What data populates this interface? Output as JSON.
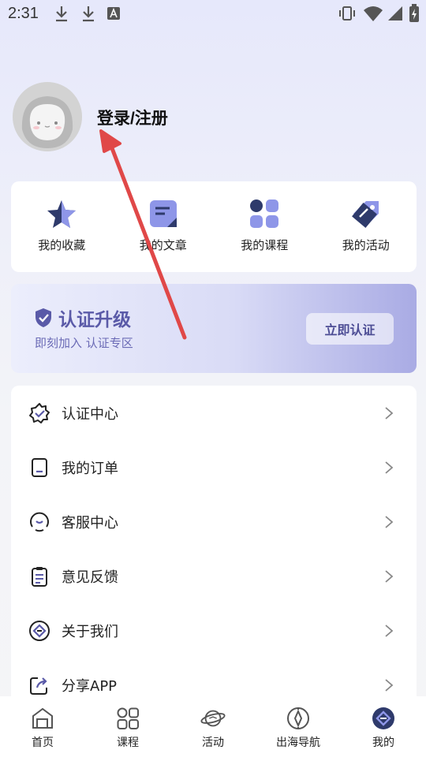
{
  "status_bar": {
    "time": "2:31"
  },
  "profile": {
    "login_text": "登录/注册"
  },
  "quick_actions": [
    {
      "label": "我的收藏",
      "icon": "star-icon"
    },
    {
      "label": "我的文章",
      "icon": "article-icon"
    },
    {
      "label": "我的课程",
      "icon": "course-grid-icon"
    },
    {
      "label": "我的活动",
      "icon": "tag-icon"
    }
  ],
  "cert": {
    "title": "认证升级",
    "subtitle": "即刻加入 认证专区",
    "button": "立即认证"
  },
  "menu": [
    {
      "label": "认证中心",
      "icon": "badge-check-icon"
    },
    {
      "label": "我的订单",
      "icon": "order-icon"
    },
    {
      "label": "客服中心",
      "icon": "customer-service-icon"
    },
    {
      "label": "意见反馈",
      "icon": "feedback-icon"
    },
    {
      "label": "关于我们",
      "icon": "about-icon"
    },
    {
      "label": "分享APP",
      "icon": "share-icon"
    }
  ],
  "bottom_nav": [
    {
      "label": "首页",
      "icon": "home-icon"
    },
    {
      "label": "课程",
      "icon": "grid-icon"
    },
    {
      "label": "活动",
      "icon": "planet-icon"
    },
    {
      "label": "出海导航",
      "icon": "compass-icon"
    },
    {
      "label": "我的",
      "icon": "profile-icon",
      "active": true
    }
  ],
  "colors": {
    "accent": "#5a5aa8",
    "arrow": "#e04848",
    "icon_dark": "#2e3a6b"
  }
}
